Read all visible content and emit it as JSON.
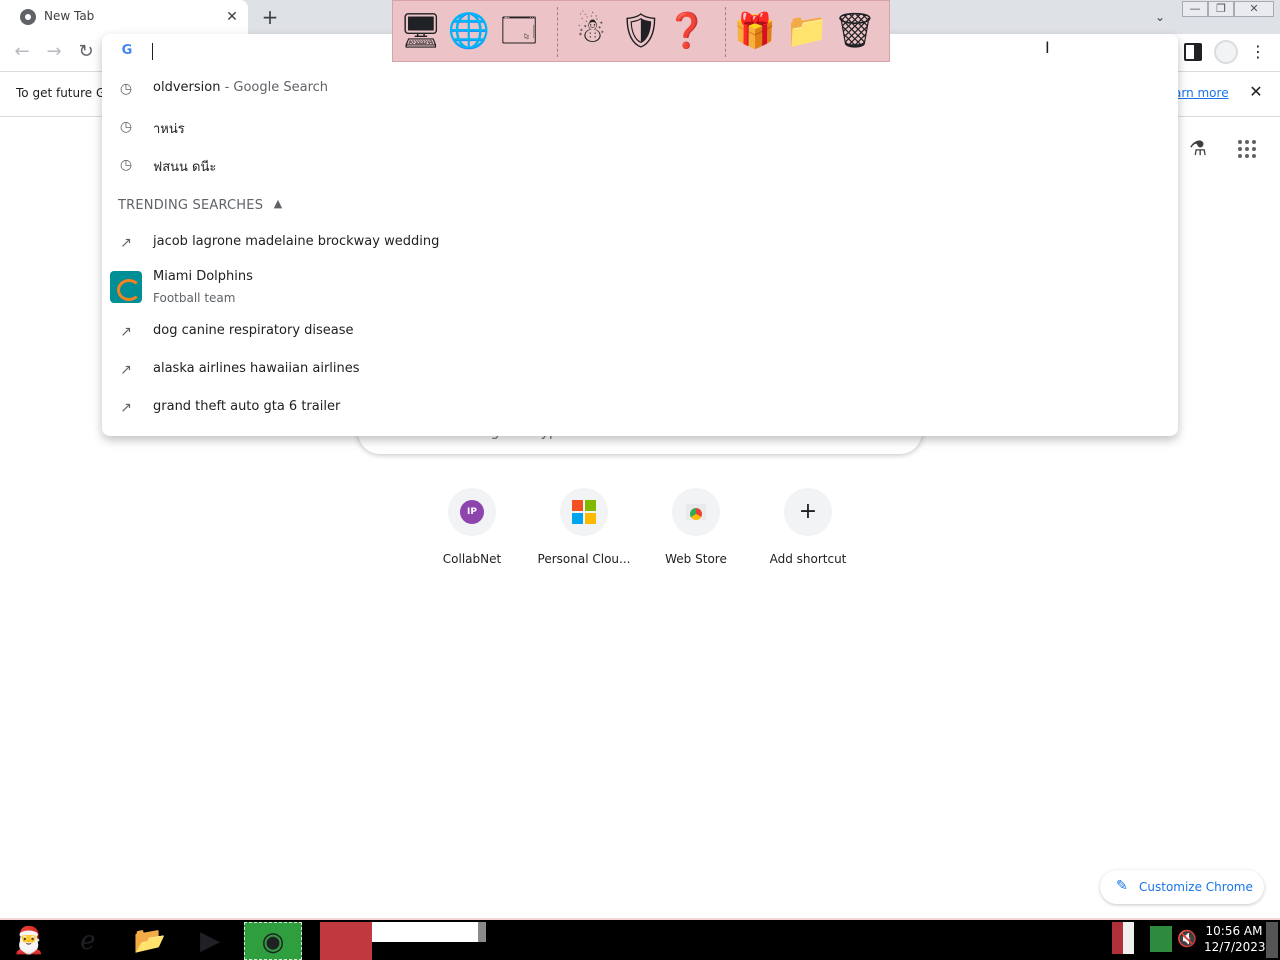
{
  "browser": {
    "tab": {
      "title": "New Tab",
      "close_icon": "close-icon"
    },
    "new_tab_label": "+",
    "tab_search_label": "⌄",
    "window_controls": {
      "minimize": "—",
      "maximize": "❐",
      "close": "✕"
    }
  },
  "toolbar": {
    "back": "←",
    "forward": "→",
    "reload": "↻",
    "menu": "⋮",
    "omnibox_value": ""
  },
  "infobar": {
    "text": "To get future G",
    "link": "arn more",
    "close": "✕"
  },
  "omnibox_popup": {
    "history": [
      {
        "query": "oldversion",
        "separator": " - ",
        "suffix": "Google Search",
        "icon": "history-clock-icon"
      },
      {
        "query": "าหน่ร",
        "separator": "",
        "suffix": "",
        "icon": "history-clock-icon"
      },
      {
        "query": "ฟสนน ดนีะ",
        "separator": "",
        "suffix": "",
        "icon": "history-clock-icon"
      }
    ],
    "trending_header": "TRENDING SEARCHES",
    "trending": [
      {
        "query": "jacob lagrone madelaine brockway wedding",
        "icon": "trending-arrow-icon"
      },
      {
        "query": "dog canine respiratory disease",
        "icon": "trending-arrow-icon"
      },
      {
        "query": "alaska airlines hawaiian airlines",
        "icon": "trending-arrow-icon"
      },
      {
        "query": "grand theft auto gta 6 trailer",
        "icon": "trending-arrow-icon"
      }
    ],
    "entity": {
      "title": "Miami Dolphins",
      "subtitle": "Football team",
      "icon": "miami-dolphins-logo-icon"
    }
  },
  "ntp": {
    "search_placeholder": "Search Google or type a URL",
    "shortcuts": [
      {
        "label": "CollabNet",
        "badge": "IP"
      },
      {
        "label": "Personal Clou..."
      },
      {
        "label": "Web Store"
      },
      {
        "label": "Add shortcut"
      }
    ],
    "customize_label": "Customize Chrome"
  },
  "taskbar": {
    "time": "10:56 AM",
    "date": "12/7/2023"
  },
  "colors": {
    "accent": "#1a73e8",
    "desk_toolbar": "#ecc3c6",
    "taskbar": "#000000"
  }
}
